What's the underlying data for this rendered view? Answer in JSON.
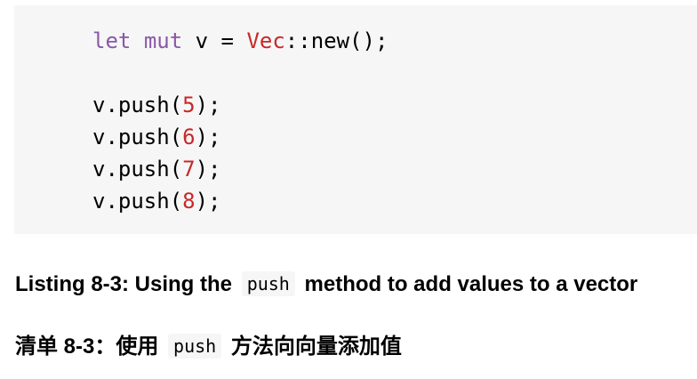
{
  "code": {
    "line1": {
      "kw_let": "let",
      "kw_mut": "mut",
      "var": "v",
      "eq": "=",
      "type": "Vec",
      "rest": "::new();"
    },
    "pushes": [
      {
        "prefix": "v.push(",
        "value": "5",
        "suffix": ");"
      },
      {
        "prefix": "v.push(",
        "value": "6",
        "suffix": ");"
      },
      {
        "prefix": "v.push(",
        "value": "7",
        "suffix": ");"
      },
      {
        "prefix": "v.push(",
        "value": "8",
        "suffix": ");"
      }
    ]
  },
  "caption_en": {
    "before": "Listing 8-3: Using the",
    "code": "push",
    "after": "method to add values to a vector"
  },
  "caption_zh": {
    "before": "清单 8-3：使用",
    "code": "push",
    "after": "方法向向量添加值"
  },
  "colors": {
    "code_background": "#f6f6f6",
    "keyword": "#8959a8",
    "type_and_number": "#c82829"
  }
}
